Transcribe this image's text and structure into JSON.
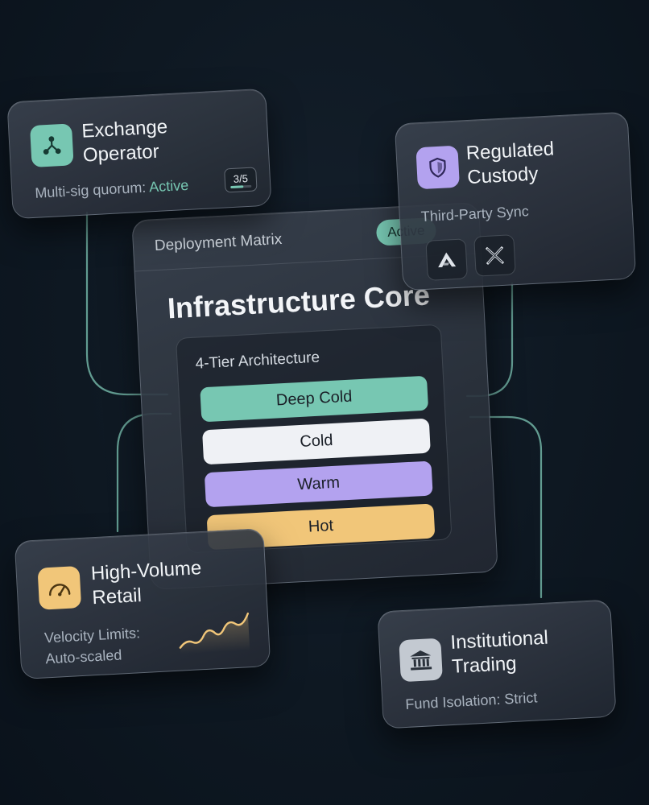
{
  "core": {
    "label": "Deployment Matrix",
    "badge": "Active",
    "title": "Infrastructure Core",
    "architecture": {
      "title": "4-Tier Architecture",
      "tiers": [
        "Deep Cold",
        "Cold",
        "Warm",
        "Hot"
      ]
    }
  },
  "cards": {
    "exchange": {
      "title_line1": "Exchange",
      "title_line2": "Operator",
      "text_prefix": "Multi-sig quorum:",
      "text_status": "Active",
      "quorum": "3/5",
      "quorum_progress": 0.6,
      "icon": "network-nodes-icon"
    },
    "custody": {
      "title_line1": "Regulated",
      "title_line2": "Custody",
      "text": "Third-Party Sync",
      "icon": "shield-icon",
      "partner_logos": [
        "arrow-mark-logo",
        "x-mark-logo"
      ]
    },
    "retail": {
      "title_line1": "High-Volume",
      "title_line2": "Retail",
      "text_line1": "Velocity Limits:",
      "text_line2": "Auto-scaled",
      "icon": "gauge-icon"
    },
    "institutional": {
      "title_line1": "Institutional",
      "title_line2": "Trading",
      "text": "Fund Isolation: Strict",
      "icon": "bank-icon"
    }
  },
  "colors": {
    "accent_teal": "#77c7b2",
    "accent_lavender": "#b3a2ef",
    "accent_amber": "#f1c679",
    "tier_light": "#eff1f5",
    "background": "#0e1822"
  }
}
